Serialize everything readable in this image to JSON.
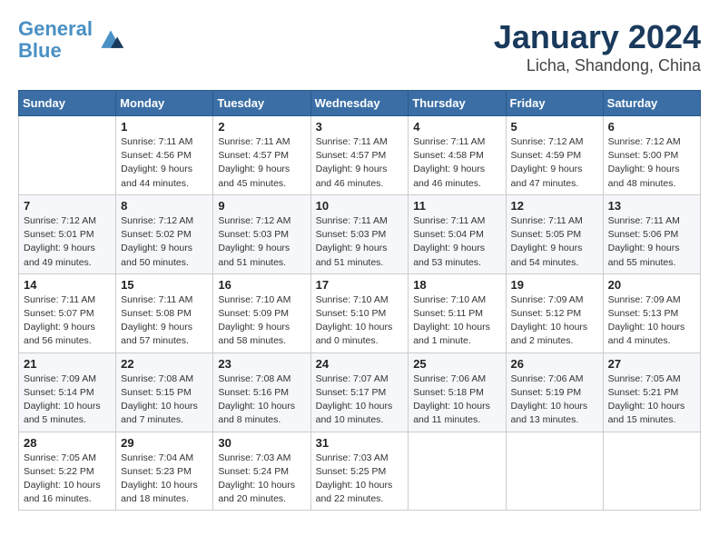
{
  "header": {
    "logo_line1": "General",
    "logo_line2": "Blue",
    "title": "January 2024",
    "subtitle": "Licha, Shandong, China"
  },
  "weekdays": [
    "Sunday",
    "Monday",
    "Tuesday",
    "Wednesday",
    "Thursday",
    "Friday",
    "Saturday"
  ],
  "weeks": [
    [
      {
        "day": "",
        "info": ""
      },
      {
        "day": "1",
        "info": "Sunrise: 7:11 AM\nSunset: 4:56 PM\nDaylight: 9 hours\nand 44 minutes."
      },
      {
        "day": "2",
        "info": "Sunrise: 7:11 AM\nSunset: 4:57 PM\nDaylight: 9 hours\nand 45 minutes."
      },
      {
        "day": "3",
        "info": "Sunrise: 7:11 AM\nSunset: 4:57 PM\nDaylight: 9 hours\nand 46 minutes."
      },
      {
        "day": "4",
        "info": "Sunrise: 7:11 AM\nSunset: 4:58 PM\nDaylight: 9 hours\nand 46 minutes."
      },
      {
        "day": "5",
        "info": "Sunrise: 7:12 AM\nSunset: 4:59 PM\nDaylight: 9 hours\nand 47 minutes."
      },
      {
        "day": "6",
        "info": "Sunrise: 7:12 AM\nSunset: 5:00 PM\nDaylight: 9 hours\nand 48 minutes."
      }
    ],
    [
      {
        "day": "7",
        "info": "Sunrise: 7:12 AM\nSunset: 5:01 PM\nDaylight: 9 hours\nand 49 minutes."
      },
      {
        "day": "8",
        "info": "Sunrise: 7:12 AM\nSunset: 5:02 PM\nDaylight: 9 hours\nand 50 minutes."
      },
      {
        "day": "9",
        "info": "Sunrise: 7:12 AM\nSunset: 5:03 PM\nDaylight: 9 hours\nand 51 minutes."
      },
      {
        "day": "10",
        "info": "Sunrise: 7:11 AM\nSunset: 5:03 PM\nDaylight: 9 hours\nand 51 minutes."
      },
      {
        "day": "11",
        "info": "Sunrise: 7:11 AM\nSunset: 5:04 PM\nDaylight: 9 hours\nand 53 minutes."
      },
      {
        "day": "12",
        "info": "Sunrise: 7:11 AM\nSunset: 5:05 PM\nDaylight: 9 hours\nand 54 minutes."
      },
      {
        "day": "13",
        "info": "Sunrise: 7:11 AM\nSunset: 5:06 PM\nDaylight: 9 hours\nand 55 minutes."
      }
    ],
    [
      {
        "day": "14",
        "info": "Sunrise: 7:11 AM\nSunset: 5:07 PM\nDaylight: 9 hours\nand 56 minutes."
      },
      {
        "day": "15",
        "info": "Sunrise: 7:11 AM\nSunset: 5:08 PM\nDaylight: 9 hours\nand 57 minutes."
      },
      {
        "day": "16",
        "info": "Sunrise: 7:10 AM\nSunset: 5:09 PM\nDaylight: 9 hours\nand 58 minutes."
      },
      {
        "day": "17",
        "info": "Sunrise: 7:10 AM\nSunset: 5:10 PM\nDaylight: 10 hours\nand 0 minutes."
      },
      {
        "day": "18",
        "info": "Sunrise: 7:10 AM\nSunset: 5:11 PM\nDaylight: 10 hours\nand 1 minute."
      },
      {
        "day": "19",
        "info": "Sunrise: 7:09 AM\nSunset: 5:12 PM\nDaylight: 10 hours\nand 2 minutes."
      },
      {
        "day": "20",
        "info": "Sunrise: 7:09 AM\nSunset: 5:13 PM\nDaylight: 10 hours\nand 4 minutes."
      }
    ],
    [
      {
        "day": "21",
        "info": "Sunrise: 7:09 AM\nSunset: 5:14 PM\nDaylight: 10 hours\nand 5 minutes."
      },
      {
        "day": "22",
        "info": "Sunrise: 7:08 AM\nSunset: 5:15 PM\nDaylight: 10 hours\nand 7 minutes."
      },
      {
        "day": "23",
        "info": "Sunrise: 7:08 AM\nSunset: 5:16 PM\nDaylight: 10 hours\nand 8 minutes."
      },
      {
        "day": "24",
        "info": "Sunrise: 7:07 AM\nSunset: 5:17 PM\nDaylight: 10 hours\nand 10 minutes."
      },
      {
        "day": "25",
        "info": "Sunrise: 7:06 AM\nSunset: 5:18 PM\nDaylight: 10 hours\nand 11 minutes."
      },
      {
        "day": "26",
        "info": "Sunrise: 7:06 AM\nSunset: 5:19 PM\nDaylight: 10 hours\nand 13 minutes."
      },
      {
        "day": "27",
        "info": "Sunrise: 7:05 AM\nSunset: 5:21 PM\nDaylight: 10 hours\nand 15 minutes."
      }
    ],
    [
      {
        "day": "28",
        "info": "Sunrise: 7:05 AM\nSunset: 5:22 PM\nDaylight: 10 hours\nand 16 minutes."
      },
      {
        "day": "29",
        "info": "Sunrise: 7:04 AM\nSunset: 5:23 PM\nDaylight: 10 hours\nand 18 minutes."
      },
      {
        "day": "30",
        "info": "Sunrise: 7:03 AM\nSunset: 5:24 PM\nDaylight: 10 hours\nand 20 minutes."
      },
      {
        "day": "31",
        "info": "Sunrise: 7:03 AM\nSunset: 5:25 PM\nDaylight: 10 hours\nand 22 minutes."
      },
      {
        "day": "",
        "info": ""
      },
      {
        "day": "",
        "info": ""
      },
      {
        "day": "",
        "info": ""
      }
    ]
  ]
}
